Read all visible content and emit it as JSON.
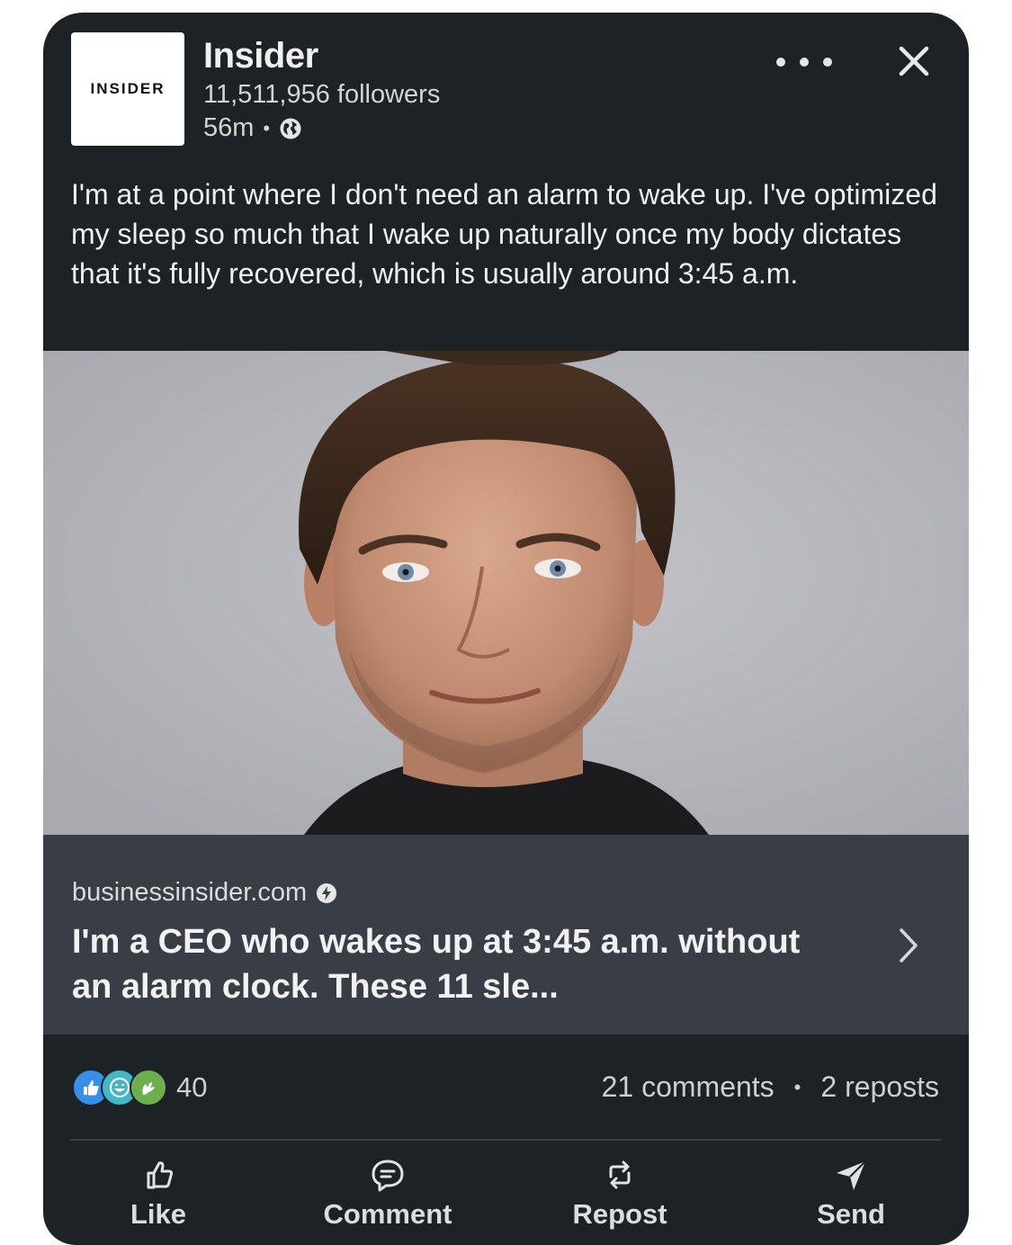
{
  "post": {
    "author": {
      "logo_text": "INSIDER",
      "name": "Insider",
      "followers": "11,511,956 followers",
      "time": "56m",
      "time_separator": "•"
    },
    "text": "I'm at a point where I don't need an alarm to wake up. I've optimized my sleep so much that I wake up naturally once my body dictates that it's fully recovered, which is usually around 3:45 a.m.",
    "link_preview": {
      "domain": "businessinsider.com",
      "title": "I'm a CEO who wakes up at 3:45 a.m. without an alarm clock. These 11 sle..."
    },
    "social": {
      "reaction_icons": [
        "like-icon",
        "funny-icon",
        "celebrate-icon"
      ],
      "reaction_count": "40",
      "comments": "21 comments",
      "separator": "•",
      "reposts": "2 reposts"
    },
    "actions": {
      "like": "Like",
      "comment": "Comment",
      "repost": "Repost",
      "send": "Send"
    }
  },
  "colors": {
    "card_background": "#1d2226",
    "preview_background": "#393e46",
    "image_background": "#b5b5bb",
    "like_blue": "#378fe9",
    "funny_teal": "#44b7c6",
    "celebrate_green": "#6dae4f"
  }
}
